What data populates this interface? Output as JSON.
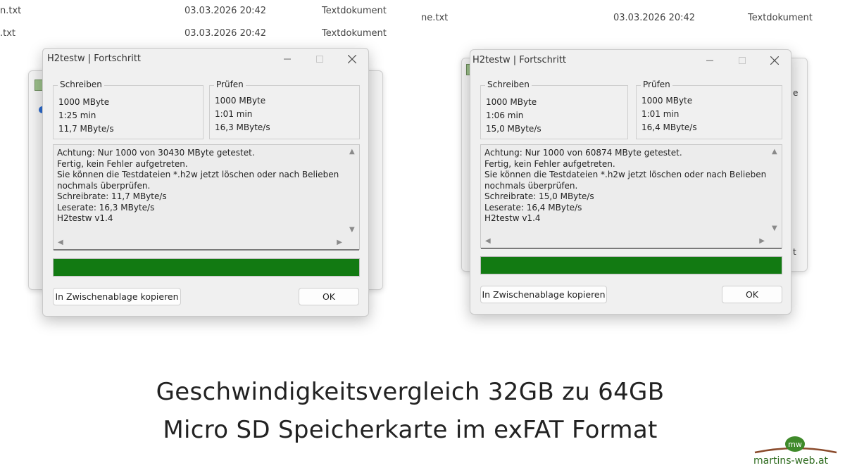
{
  "explorer": {
    "left_rows": [
      {
        "name": "n.txt",
        "date": "03.03.2026 20:42",
        "type": "Textdokument"
      },
      {
        "name": ".txt",
        "date": "03.03.2026 20:42",
        "type": "Textdokument"
      }
    ],
    "right_row": {
      "name": "ne.txt",
      "date": "03.03.2026 20:42",
      "type": "Textdokument"
    }
  },
  "dialogs": [
    {
      "title": "H2testw | Fortschritt",
      "write": {
        "label": "Schreiben",
        "size": "1000 MByte",
        "time": "1:25 min",
        "rate": "11,7 MByte/s"
      },
      "verify": {
        "label": "Prüfen",
        "size": "1000 MByte",
        "time": "1:01 min",
        "rate": "16,3 MByte/s"
      },
      "log": "Achtung: Nur 1000 von 30430 MByte getestet.\nFertig, kein Fehler aufgetreten.\nSie können die Testdateien *.h2w jetzt löschen oder nach Belieben\nnochmals überprüfen.\nSchreibrate: 11,7 MByte/s\nLeserate: 16,3 MByte/s\nH2testw v1.4",
      "progress": 1.0,
      "copy_button": "In Zwischenablage kopieren",
      "ok_button": "OK"
    },
    {
      "title": "H2testw | Fortschritt",
      "write": {
        "label": "Schreiben",
        "size": "1000 MByte",
        "time": "1:06 min",
        "rate": "15,0 MByte/s"
      },
      "verify": {
        "label": "Prüfen",
        "size": "1000 MByte",
        "time": "1:01 min",
        "rate": "16,4 MByte/s"
      },
      "log": "Achtung: Nur 1000 von 60874 MByte getestet.\nFertig, kein Fehler aufgetreten.\nSie können die Testdateien *.h2w jetzt löschen oder nach Belieben\nnochmals überprüfen.\nSchreibrate: 15,0 MByte/s\nLeserate: 16,4 MByte/s\nH2testw v1.4",
      "progress": 1.0,
      "copy_button": "In Zwischenablage kopieren",
      "ok_button": "OK"
    }
  ],
  "background_fragments": {
    "right_window_letter_1": "e",
    "right_window_letter_2": "t"
  },
  "caption": {
    "line1": "Geschwindigkeitsvergleich 32GB zu 64GB",
    "line2": "Micro SD Speicherkarte im exFAT Format"
  },
  "logo": {
    "monogram": "mw",
    "text": "martins-web.at"
  },
  "colors": {
    "progress": "#127a12",
    "logo_green": "#2e6b1e",
    "logo_brown": "#8a4a2b"
  },
  "icons": {
    "minimize": "minimize-icon",
    "maximize": "maximize-icon",
    "close": "close-icon"
  }
}
